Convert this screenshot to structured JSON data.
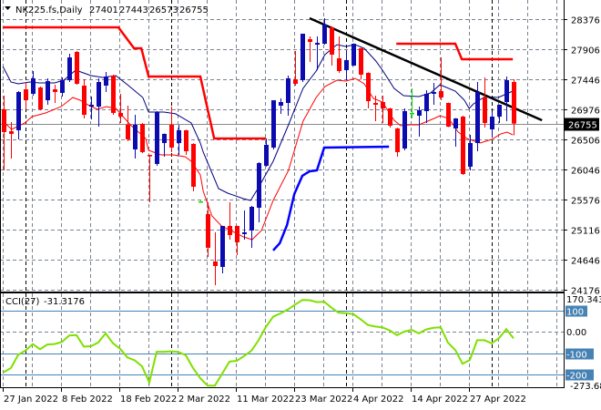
{
  "header": {
    "symbol": "NK225.fs,Daily",
    "open": "27401",
    "high": "27443",
    "low": "26573",
    "close": "26755"
  },
  "colors": {
    "bull": "#0b0bb0",
    "bear": "#ff0000",
    "doji": "#00e000",
    "ma_upper": "#000080",
    "ma_lower": "#ff0000",
    "channel_upper": "#ff0000",
    "channel_lower": "#0000ff",
    "trendline": "#000000",
    "cci": "#7fe000",
    "level": "#4682b4"
  },
  "chart_data": [
    {
      "type": "candlestick",
      "title": "NK225.fs,Daily",
      "ylim": [
        24176,
        28376
      ],
      "y_ticks": [
        "28376",
        "27906",
        "27446",
        "26976",
        "26506",
        "26046",
        "25576",
        "25116",
        "24646",
        "24176"
      ],
      "current_price": 26755,
      "current_price_label": "26755",
      "x_tick_labels": [
        {
          "index": 0,
          "label": "27 Jan 2022"
        },
        {
          "index": 8,
          "label": "8 Feb 2022"
        },
        {
          "index": 16,
          "label": "18 Feb 2022"
        },
        {
          "index": 24,
          "label": "2 Mar 2022"
        },
        {
          "index": 32,
          "label": "11 Mar 2022"
        },
        {
          "index": 40,
          "label": "23 Mar 2022"
        },
        {
          "index": 48,
          "label": "4 Apr 2022"
        },
        {
          "index": 56,
          "label": "14 Apr 2022"
        },
        {
          "index": 64,
          "label": "27 Apr 2022"
        }
      ],
      "period_separators": [
        3,
        23,
        47,
        67
      ],
      "ohlc": [
        [
          26976,
          27188,
          26029,
          26623
        ],
        [
          26637,
          26778,
          26213,
          26595
        ],
        [
          26651,
          27259,
          26510,
          27245
        ],
        [
          27287,
          27400,
          26976,
          27117
        ],
        [
          27217,
          27570,
          27188,
          27457
        ],
        [
          27315,
          27330,
          26960,
          26976
        ],
        [
          27117,
          27457,
          27047,
          27414
        ],
        [
          27287,
          27358,
          27075,
          27245
        ],
        [
          27231,
          27471,
          27174,
          27428
        ],
        [
          27428,
          27839,
          27400,
          27782
        ],
        [
          27867,
          27881,
          27358,
          27372
        ],
        [
          27344,
          27443,
          26835,
          26891
        ],
        [
          27018,
          27174,
          26820,
          27047
        ],
        [
          27018,
          27457,
          26707,
          27400
        ],
        [
          27344,
          27556,
          27245,
          27485
        ],
        [
          27500,
          27514,
          26891,
          26920
        ],
        [
          26920,
          27217,
          26764,
          26863
        ],
        [
          26736,
          27033,
          26481,
          26510
        ],
        [
          26354,
          26891,
          26213,
          26736
        ],
        [
          26750,
          26764,
          26298,
          26312
        ],
        [
          26269,
          26269,
          25534,
          26255
        ],
        [
          26128,
          26948,
          26100,
          26934
        ],
        [
          26453,
          26600,
          26241,
          26595
        ],
        [
          26736,
          27018,
          26312,
          26382
        ],
        [
          26453,
          26736,
          26269,
          26651
        ],
        [
          26651,
          26660,
          26269,
          26326
        ],
        [
          26439,
          26450,
          25703,
          25774
        ],
        [
          25548,
          25560,
          25536,
          25548
        ],
        [
          25350,
          25534,
          24685,
          24827
        ],
        [
          24615,
          25067,
          24247,
          24544
        ],
        [
          24530,
          25166,
          24431,
          25166
        ],
        [
          25166,
          25534,
          24954,
          25025
        ],
        [
          25166,
          25170,
          24714,
          24912
        ],
        [
          25039,
          25407,
          24954,
          25067
        ],
        [
          25096,
          25477,
          24827,
          25463
        ],
        [
          25449,
          26156,
          25223,
          26142
        ],
        [
          26100,
          26524,
          26086,
          26425
        ],
        [
          26382,
          27117,
          26354,
          27117
        ],
        [
          27033,
          27146,
          26906,
          27089
        ],
        [
          27075,
          27500,
          26877,
          27457
        ],
        [
          27443,
          27881,
          27344,
          27372
        ],
        [
          27429,
          28150,
          27400,
          28150
        ],
        [
          28065,
          28107,
          27712,
          28022
        ],
        [
          27980,
          28107,
          27584,
          28008
        ],
        [
          27994,
          28390,
          27980,
          28291
        ],
        [
          28249,
          28260,
          27655,
          27825
        ],
        [
          27768,
          28107,
          27542,
          27570
        ],
        [
          27584,
          27895,
          27429,
          27740
        ],
        [
          27655,
          28000,
          27650,
          27994
        ],
        [
          27924,
          27930,
          27443,
          27514
        ],
        [
          27542,
          27550,
          26990,
          27103
        ],
        [
          27075,
          27188,
          26792,
          27047
        ],
        [
          27089,
          27188,
          26764,
          26990
        ],
        [
          26990,
          27000,
          26693,
          26722
        ],
        [
          26680,
          26690,
          26241,
          26312
        ],
        [
          26368,
          26990,
          26340,
          26948
        ],
        [
          26920,
          27301,
          26835,
          26920
        ],
        [
          26877,
          27018,
          26552,
          26962
        ],
        [
          26948,
          27273,
          26764,
          27217
        ],
        [
          27217,
          27386,
          27047,
          27245
        ],
        [
          27259,
          27782,
          27117,
          27160
        ],
        [
          27075,
          27080,
          26700,
          26707
        ],
        [
          26679,
          26840,
          26396,
          26835
        ],
        [
          26863,
          26877,
          25958,
          25972
        ],
        [
          26086,
          26580,
          26029,
          26453
        ],
        [
          26453,
          27400,
          26326,
          27245
        ],
        [
          27160,
          27471,
          26693,
          26764
        ],
        [
          26665,
          26934,
          26538,
          26863
        ],
        [
          26863,
          27050,
          26764,
          27047
        ],
        [
          27089,
          27485,
          26792,
          27429
        ],
        [
          27401,
          27443,
          26573,
          26755
        ]
      ],
      "overlays": {
        "ma_upper": [
          [
            -0.1,
            27641
          ],
          [
            1,
            27400
          ],
          [
            2,
            27372
          ],
          [
            3.6,
            27400
          ],
          [
            4.9,
            27386
          ],
          [
            7,
            27386
          ],
          [
            8.25,
            27429
          ],
          [
            9.9,
            27584
          ],
          [
            12,
            27499
          ],
          [
            13.6,
            27471
          ],
          [
            15.4,
            27499
          ],
          [
            17,
            27358
          ],
          [
            19.1,
            27160
          ],
          [
            19.9,
            26934
          ],
          [
            22,
            26934
          ],
          [
            23.6,
            26906
          ],
          [
            25.75,
            26764
          ],
          [
            27,
            26453
          ],
          [
            27.4,
            26312
          ],
          [
            29.5,
            25746
          ],
          [
            30.75,
            25675
          ],
          [
            32.9,
            25590
          ],
          [
            33.9,
            25562
          ],
          [
            34.9,
            25746
          ],
          [
            37,
            26170
          ],
          [
            39.1,
            26736
          ],
          [
            41.1,
            27301
          ],
          [
            42.9,
            27570
          ],
          [
            44.1,
            27825
          ],
          [
            45.75,
            27980
          ],
          [
            47,
            27952
          ],
          [
            48.25,
            27980
          ],
          [
            49.5,
            27924
          ],
          [
            51.1,
            27726
          ],
          [
            52,
            27584
          ],
          [
            53.6,
            27301
          ],
          [
            54.9,
            27188
          ],
          [
            57,
            27174
          ],
          [
            58.6,
            27231
          ],
          [
            59.9,
            27358
          ],
          [
            62,
            27259
          ],
          [
            63.25,
            27117
          ],
          [
            63.9,
            26990
          ],
          [
            64.5,
            27061
          ],
          [
            66.1,
            27174
          ],
          [
            67.9,
            27160
          ],
          [
            69.9,
            27259
          ]
        ],
        "ma_lower": [
          [
            -0.1,
            26792
          ],
          [
            1.1,
            26665
          ],
          [
            2.9,
            26764
          ],
          [
            3.9,
            26863
          ],
          [
            5.75,
            26920
          ],
          [
            7.9,
            27019
          ],
          [
            9.5,
            27160
          ],
          [
            10.5,
            27118
          ],
          [
            12,
            27019
          ],
          [
            12.9,
            26976
          ],
          [
            14.1,
            27019
          ],
          [
            15.4,
            26990
          ],
          [
            17.4,
            26736
          ],
          [
            19.5,
            26524
          ],
          [
            19.9,
            26340
          ],
          [
            21.6,
            26269
          ],
          [
            23.25,
            26269
          ],
          [
            24.9,
            26241
          ],
          [
            25.75,
            26170
          ],
          [
            27,
            25958
          ],
          [
            27.4,
            25703
          ],
          [
            28.6,
            25322
          ],
          [
            29.9,
            25166
          ],
          [
            32.9,
            24997
          ],
          [
            34.1,
            24954
          ],
          [
            35.4,
            25096
          ],
          [
            37,
            25562
          ],
          [
            39.1,
            26029
          ],
          [
            41.1,
            26792
          ],
          [
            42.9,
            27160
          ],
          [
            44.1,
            27330
          ],
          [
            45.75,
            27429
          ],
          [
            47,
            27415
          ],
          [
            48.25,
            27457
          ],
          [
            49.5,
            27372
          ],
          [
            50.75,
            27146
          ],
          [
            52,
            27089
          ],
          [
            53.6,
            26806
          ],
          [
            54.5,
            26722
          ],
          [
            55.75,
            26736
          ],
          [
            57,
            26736
          ],
          [
            59.1,
            26835
          ],
          [
            59.9,
            26877
          ],
          [
            61.1,
            26835
          ],
          [
            62.4,
            26623
          ],
          [
            63.6,
            26524
          ],
          [
            65.4,
            26453
          ],
          [
            67,
            26510
          ],
          [
            68.25,
            26594
          ],
          [
            69.1,
            26623
          ],
          [
            69.9,
            26580
          ]
        ],
        "channel_upper": [
          [
            [
              -0.1,
              28249
            ],
            [
              15.75,
              28249
            ],
            [
              17.9,
              27924
            ],
            [
              18.9,
              27924
            ],
            [
              19.9,
              27485
            ],
            [
              27,
              27485
            ],
            [
              28.9,
              26524
            ],
            [
              36,
              26524
            ]
          ],
          [
            [
              53.9,
              27994
            ],
            [
              62,
              27994
            ],
            [
              62.9,
              27754
            ],
            [
              69.9,
              27754
            ]
          ]
        ],
        "channel_lower": [
          [
            37,
            24785
          ],
          [
            37.9,
            24897
          ],
          [
            38.9,
            25180
          ],
          [
            39.9,
            25661
          ],
          [
            41,
            25944
          ],
          [
            42,
            26015
          ],
          [
            43,
            26029
          ],
          [
            44,
            26382
          ],
          [
            52.9,
            26396
          ]
        ],
        "trendline": [
          [
            42,
            28390
          ],
          [
            73.9,
            26806
          ]
        ]
      }
    },
    {
      "type": "line",
      "title": "CCI(27)",
      "current_value": "-31.3176",
      "ylim": [
        -273.68,
        170.3435
      ],
      "y_labels": {
        "max": "170.3435",
        "min": "-273.680",
        "zero": "0.00"
      },
      "levels": [
        {
          "value": 100,
          "label": "100"
        },
        {
          "value": -100,
          "label": "-100"
        },
        {
          "value": -200,
          "label": "-200"
        }
      ],
      "values": [
        -190,
        -170,
        -108,
        -88,
        -58,
        -82,
        -60,
        -58,
        -48,
        -18,
        -16,
        -70,
        -68,
        -50,
        -8,
        -54,
        -80,
        -121,
        -134,
        -162,
        -238,
        -94,
        -94,
        -92,
        -95,
        -110,
        -170,
        -218,
        -252,
        -252,
        -196,
        -140,
        -136,
        -114,
        -90,
        -40,
        22,
        70,
        85,
        103,
        126,
        148,
        147,
        138,
        140,
        112,
        88,
        86,
        82,
        58,
        31,
        24,
        20,
        6,
        -16,
        0,
        8,
        -8,
        10,
        18,
        20,
        -52,
        -86,
        -150,
        -132,
        -40,
        -40,
        -55,
        -30,
        12,
        -31.3176
      ]
    }
  ]
}
